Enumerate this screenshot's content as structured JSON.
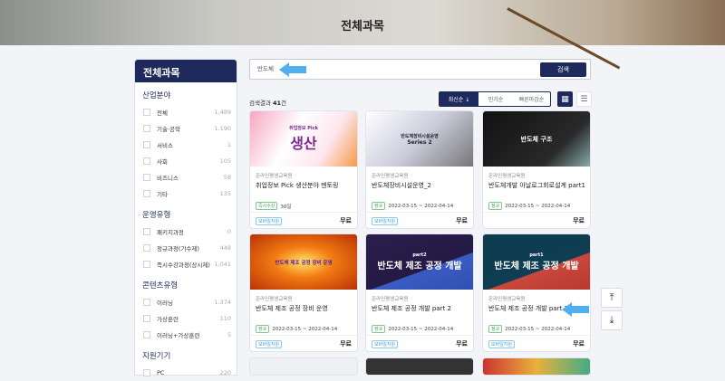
{
  "banner": {
    "title": "전체과목"
  },
  "sidebar": {
    "title": "전체과목",
    "groups": [
      {
        "label": "산업분야",
        "items": [
          {
            "label": "전체",
            "count": "1,489"
          },
          {
            "label": "기술·공학",
            "count": "1,190"
          },
          {
            "label": "서비스",
            "count": "1"
          },
          {
            "label": "사회",
            "count": "105"
          },
          {
            "label": "비즈니스",
            "count": "58"
          },
          {
            "label": "기타",
            "count": "135"
          }
        ]
      },
      {
        "label": "운영유형",
        "items": [
          {
            "label": "패키지과정",
            "count": "0"
          },
          {
            "label": "정규과정(기수제)",
            "count": "448"
          },
          {
            "label": "즉시수강과정(상시제)",
            "count": "1,041"
          }
        ]
      },
      {
        "label": "콘텐츠유형",
        "items": [
          {
            "label": "이러닝",
            "count": "1,374"
          },
          {
            "label": "가상훈련",
            "count": "110"
          },
          {
            "label": "이러닝+가상훈련",
            "count": "5"
          }
        ]
      },
      {
        "label": "지원기기",
        "items": [
          {
            "label": "PC",
            "count": "220"
          }
        ]
      }
    ]
  },
  "search": {
    "value": "반도체",
    "button": "검색"
  },
  "results": {
    "prefix": "검색결과 ",
    "count": "41",
    "suffix": "건"
  },
  "sort": {
    "options": [
      "최신순 ↓",
      "인기순",
      "빠른마감순"
    ]
  },
  "cards": [
    {
      "thumb": "생산",
      "thumb_sub": "취업정보 Pick",
      "org": "온라인평생교육원",
      "title": "취업정보 Pick 생산분야 멘토링",
      "tag": "즉시수강",
      "period": "30일",
      "device": "모바일지원",
      "price": "무료"
    },
    {
      "thumb": "Series 2",
      "thumb_sub": "반도체장비시설운영",
      "org": "온라인평생교육원",
      "title": "반도체장비시설운영_2",
      "tag": "정규",
      "period": "2022-03-15 ~ 2022-04-14",
      "device": "모바일지원",
      "price": "무료"
    },
    {
      "thumb": "반도체 구조",
      "thumb_sub": "",
      "org": "온라인평생교육원",
      "title": "반도체개발 아날로그회로설계 part1",
      "tag": "정규",
      "period": "2022-03-15 ~ 2022-04-14",
      "device": "",
      "price": "무료"
    },
    {
      "thumb": "반도체 제조 공정 장비 운영",
      "thumb_sub": "",
      "org": "온라인평생교육원",
      "title": "반도체 제조 공정 장비 운영",
      "tag": "정규",
      "period": "2022-03-15 ~ 2022-04-14",
      "device": "모바일지원",
      "price": "무료"
    },
    {
      "thumb": "반도체 제조 공정 개발",
      "thumb_sub": "part2",
      "org": "온라인평생교육원",
      "title": "반도체 제조 공정 개발 part 2",
      "tag": "정규",
      "period": "2022-03-15 ~ 2022-04-14",
      "device": "모바일지원",
      "price": "무료"
    },
    {
      "thumb": "반도체 제조 공정 개발",
      "thumb_sub": "part1",
      "org": "온라인평생교육원",
      "title": "반도체 제조 공정 개발 part 1",
      "tag": "정규",
      "period": "2022-03-15 ~ 2022-04-14",
      "device": "모바일지원",
      "price": "무료"
    }
  ],
  "floating": {
    "top": "⤒",
    "down": "⤓"
  }
}
